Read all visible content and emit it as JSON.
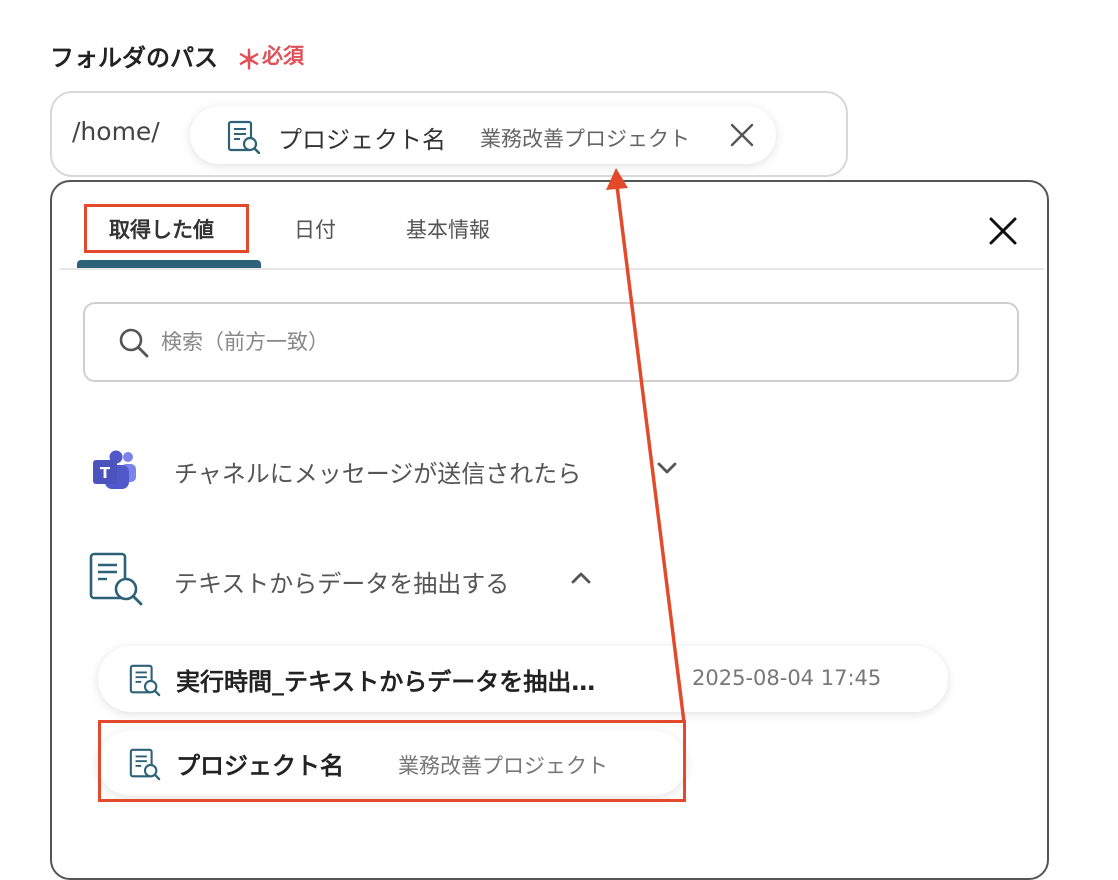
{
  "field": {
    "label": "フォルダのパス",
    "required_mark": "＊",
    "required_text": "必須"
  },
  "path_input": {
    "prefix": "/home/",
    "chip": {
      "icon": "document-search-icon",
      "name": "プロジェクト名",
      "value": "業務改善プロジェクト",
      "remove_icon": "close-icon"
    }
  },
  "panel": {
    "tabs": [
      {
        "label": "取得した値",
        "active": true
      },
      {
        "label": "日付",
        "active": false
      },
      {
        "label": "基本情報",
        "active": false
      }
    ],
    "close_icon": "close-icon",
    "search": {
      "placeholder": "検索（前方一致）",
      "value": "",
      "icon": "search-icon"
    },
    "sections": [
      {
        "title": "チャネルにメッセージが送信されたら",
        "icon": "teams-icon",
        "expanded": false,
        "chevron": "chevron-down-icon"
      },
      {
        "title": "テキストからデータを抽出する",
        "icon": "document-search-icon",
        "expanded": true,
        "chevron": "chevron-up-icon"
      }
    ],
    "items": [
      {
        "name": "実行時間_テキストからデータを抽出…",
        "value": "2025-08-04 17:45",
        "icon": "document-search-icon"
      },
      {
        "name": "プロジェクト名",
        "value": "業務改善プロジェクト",
        "icon": "document-search-icon"
      }
    ]
  },
  "colors": {
    "required": "#e0505a",
    "highlight": "#e34a2c",
    "tab_active_underline": "#2d6178",
    "icon_teal": "#2d6178"
  }
}
